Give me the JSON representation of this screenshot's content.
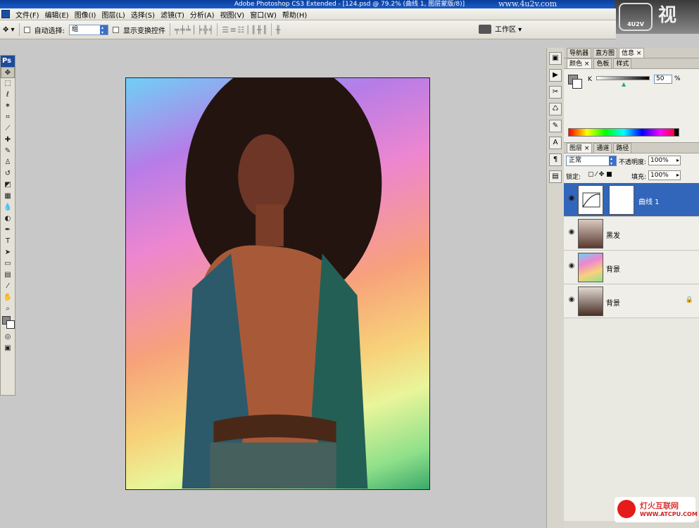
{
  "window": {
    "title": "Adobe Photoshop CS3 Extended - [124.psd @ 79.2% (曲线 1, 图层蒙版/8)]",
    "watermark_url": "www.4u2v.com",
    "corner_logo_text": "视",
    "corner_badge": "4U2V"
  },
  "menu": [
    "文件(F)",
    "编辑(E)",
    "图像(I)",
    "图层(L)",
    "选择(S)",
    "滤镜(T)",
    "分析(A)",
    "视图(V)",
    "窗口(W)",
    "帮助(H)"
  ],
  "options": {
    "auto_select_label": "自动选择:",
    "auto_select_value": "组",
    "show_transform_label": "显示变换控件",
    "workspace_label": "工作区 ▾"
  },
  "toolbox": {
    "ps_label": "Ps",
    "tools": [
      "move-tool",
      "marquee-tool",
      "lasso-tool",
      "magic-wand-tool",
      "crop-tool",
      "slice-tool",
      "healing-brush-tool",
      "brush-tool",
      "clone-stamp-tool",
      "history-brush-tool",
      "eraser-tool",
      "gradient-tool",
      "blur-tool",
      "dodge-tool",
      "pen-tool",
      "type-tool",
      "path-selection-tool",
      "shape-tool",
      "notes-tool",
      "eyedropper-tool",
      "hand-tool",
      "zoom-tool"
    ]
  },
  "panels": {
    "top_tabs": [
      "导航器",
      "直方图",
      "信息 ×"
    ],
    "color_tabs": [
      "颜色 ×",
      "色板",
      "样式"
    ],
    "color": {
      "channel_label": "K",
      "value": "50",
      "unit": "%",
      "level": 0.5
    },
    "layer_tabs": [
      "图层 ×",
      "通道",
      "路径"
    ],
    "blend_mode": "正常",
    "opacity_label": "不透明度:",
    "opacity_value": "100%",
    "lock_label": "锁定:",
    "fill_label": "填充:",
    "fill_value": "100%",
    "layers": [
      {
        "name": "曲线 1",
        "selected": true
      },
      {
        "name": "黑发",
        "selected": false
      },
      {
        "name": "背景",
        "selected": false
      },
      {
        "name": "背景",
        "selected": false,
        "locked": true
      }
    ]
  },
  "footer_watermark": {
    "line1": "灯火互联网",
    "line2": "WWW.ATCPU.COM"
  }
}
